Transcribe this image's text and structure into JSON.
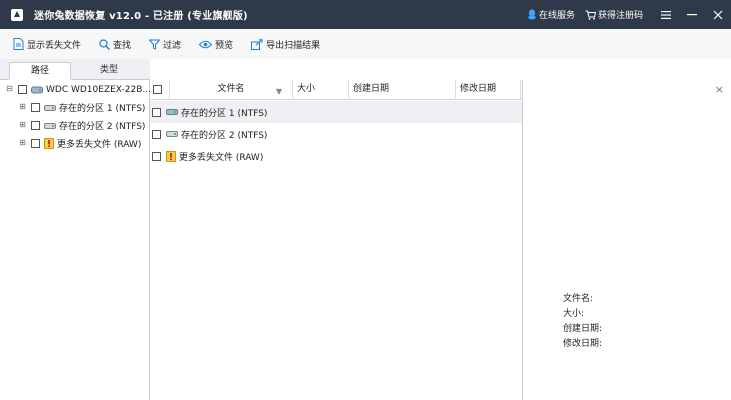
{
  "titlebar": {
    "title": "迷你兔数据恢复 v12.0 - 已注册 (专业旗舰版)",
    "online_service": "在线服务",
    "get_code": "获得注册码"
  },
  "toolbar": {
    "show_lost": "显示丢失文件",
    "find": "查找",
    "filter": "过滤",
    "preview": "预览",
    "export": "导出扫描结果"
  },
  "tabs": {
    "path": "路径",
    "type": "类型"
  },
  "tree": {
    "items": [
      {
        "label": "WDC WD10EZEX-22B..."
      },
      {
        "label": "存在的分区 1 (NTFS)"
      },
      {
        "label": "存在的分区 2 (NTFS)"
      },
      {
        "label": "更多丢失文件 (RAW)"
      }
    ]
  },
  "table": {
    "headers": {
      "name": "文件名",
      "size": "大小",
      "created": "创建日期",
      "modified": "修改日期"
    },
    "rows": [
      {
        "name": "存在的分区 1 (NTFS)"
      },
      {
        "name": "存在的分区 2 (NTFS)"
      },
      {
        "name": "更多丢失文件 (RAW)"
      }
    ]
  },
  "preview": {
    "close": "×",
    "file_name_label": "文件名:",
    "size_label": "大小:",
    "created_label": "创建日期:",
    "modified_label": "修改日期:"
  },
  "colors": {
    "titlebar": "#2e3a4a",
    "accent": "#1f7fd6",
    "selected_row": "#eef0f3"
  }
}
